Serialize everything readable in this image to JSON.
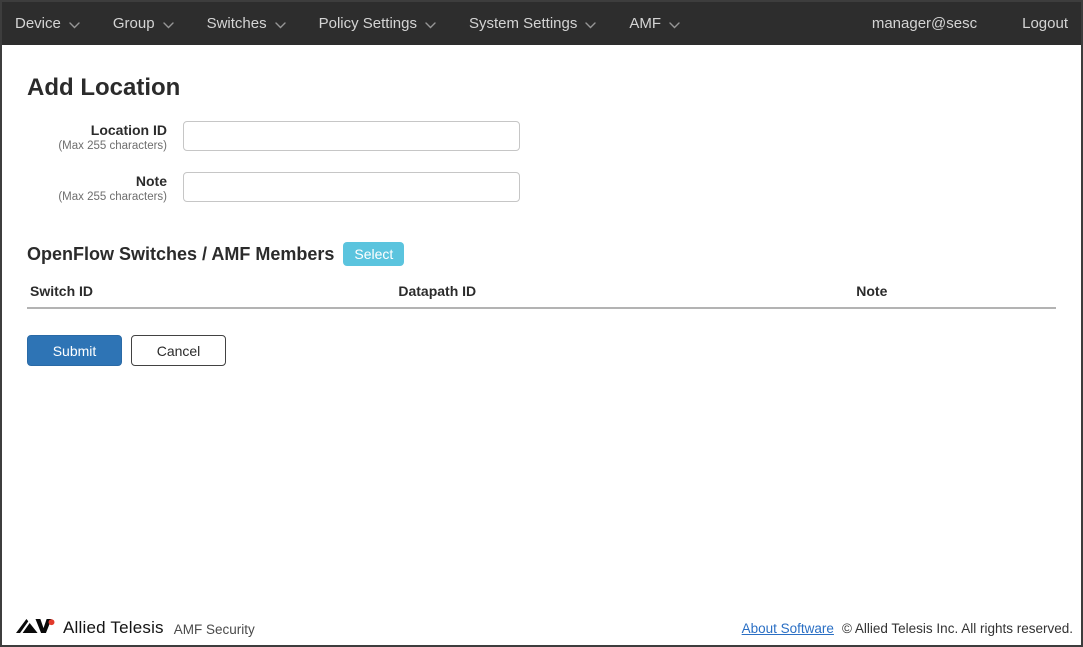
{
  "navbar": {
    "items": [
      {
        "label": "Device"
      },
      {
        "label": "Group"
      },
      {
        "label": "Switches"
      },
      {
        "label": "Policy Settings"
      },
      {
        "label": "System Settings"
      },
      {
        "label": "AMF"
      }
    ],
    "user": "manager@sesc",
    "logout_label": "Logout"
  },
  "page": {
    "title": "Add Location"
  },
  "form": {
    "fields": [
      {
        "label": "Location ID",
        "hint": "(Max 255 characters)",
        "value": ""
      },
      {
        "label": "Note",
        "hint": "(Max 255 characters)",
        "value": ""
      }
    ]
  },
  "members": {
    "heading": "OpenFlow Switches / AMF Members",
    "select_label": "Select",
    "table": {
      "columns": [
        "Switch ID",
        "Datapath ID",
        "Note"
      ],
      "rows": []
    }
  },
  "actions": {
    "submit": "Submit",
    "cancel": "Cancel"
  },
  "footer": {
    "brand": "Allied Telesis",
    "product": "AMF Security",
    "about_link": "About Software",
    "copyright": "© Allied Telesis Inc. All rights reserved."
  },
  "colors": {
    "navbar_bg": "#2d2d2d",
    "submit_blue": "#2e74b5",
    "select_info_blue": "#5bc4de",
    "link_blue": "#2a6fc4",
    "logo_red": "#e23a2b"
  }
}
